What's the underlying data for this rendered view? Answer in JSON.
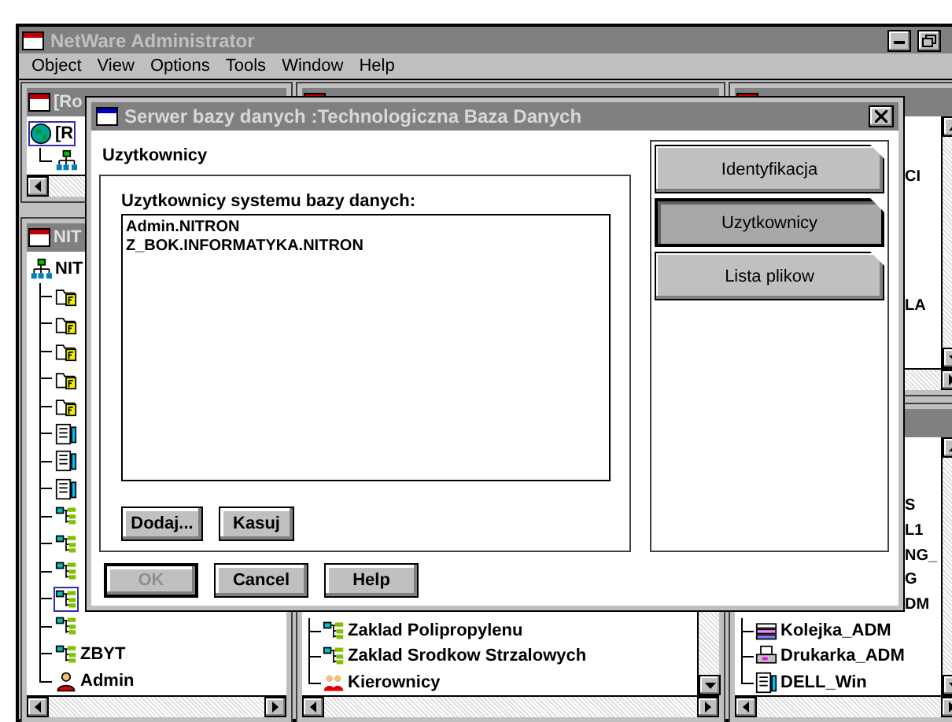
{
  "app": {
    "title": "NetWare Administrator"
  },
  "menu": [
    "Object",
    "View",
    "Options",
    "Tools",
    "Window",
    "Help"
  ],
  "top_left_window": {
    "title": "[Ro",
    "tree": [
      {
        "kind": "root",
        "label": "[R",
        "selected": true,
        "children": [
          {
            "kind": "organization",
            "selected": false
          }
        ]
      }
    ]
  },
  "left_window": {
    "title": "NIT",
    "tree": [
      {
        "kind": "organization",
        "label": "NIT",
        "selected": false,
        "children": [
          {
            "kind": "volume",
            "selected": false
          },
          {
            "kind": "volume",
            "selected": false
          },
          {
            "kind": "volume",
            "selected": false
          },
          {
            "kind": "volume",
            "selected": false
          },
          {
            "kind": "volume",
            "selected": false
          },
          {
            "kind": "server",
            "selected": false
          },
          {
            "kind": "server",
            "selected": false
          },
          {
            "kind": "server",
            "selected": false
          },
          {
            "kind": "org-unit",
            "selected": false
          },
          {
            "kind": "org-unit",
            "selected": false
          },
          {
            "kind": "org-unit",
            "selected": false
          },
          {
            "kind": "org-unit",
            "selected": true
          },
          {
            "kind": "org-unit",
            "selected": false
          },
          {
            "kind": "org-unit",
            "label": "ZBYT",
            "selected": false
          },
          {
            "kind": "user",
            "label": "Admin",
            "selected": false
          }
        ]
      }
    ]
  },
  "middle_window": {
    "items": [
      {
        "kind": "org-unit",
        "label": "Zaklad Polipropylenu"
      },
      {
        "kind": "org-unit",
        "label": "Zaklad Srodkow Strzalowych"
      },
      {
        "kind": "group",
        "label": "Kierownicy"
      }
    ]
  },
  "right_top_window": {
    "items": [
      {
        "kind": "fragment",
        "label": "CI"
      },
      {
        "kind": "fragment",
        "label": "LA"
      }
    ]
  },
  "right_bottom_window": {
    "items": [
      {
        "kind": "fragment",
        "label": "S"
      },
      {
        "kind": "fragment",
        "label": "L1"
      },
      {
        "kind": "fragment",
        "label": "NG_"
      },
      {
        "kind": "fragment",
        "label": "G"
      },
      {
        "kind": "fragment",
        "label": "DM"
      },
      {
        "kind": "queue",
        "label": "Kolejka_ADM"
      },
      {
        "kind": "printer",
        "label": "Drukarka_ADM"
      },
      {
        "kind": "server",
        "label": "DELL_Win"
      }
    ]
  },
  "dialog": {
    "title": "Serwer bazy danych :Technologiczna Baza Danych",
    "section_title": "Uzytkownicy",
    "group_label": "Uzytkownicy systemu bazy danych:",
    "list_items": [
      "Admin.NITRON",
      "Z_BOK.INFORMATYKA.NITRON"
    ],
    "list_buttons": [
      "Dodaj...",
      "Kasuj"
    ],
    "pages": [
      {
        "label": "Identyfikacja",
        "selected": false
      },
      {
        "label": "Uzytkownicy",
        "selected": true
      },
      {
        "label": "Lista plikow",
        "selected": false
      }
    ],
    "buttons": [
      {
        "label": "OK",
        "disabled": true,
        "default": true
      },
      {
        "label": "Cancel",
        "disabled": false,
        "default": false
      },
      {
        "label": "Help",
        "disabled": false,
        "default": false
      }
    ]
  }
}
